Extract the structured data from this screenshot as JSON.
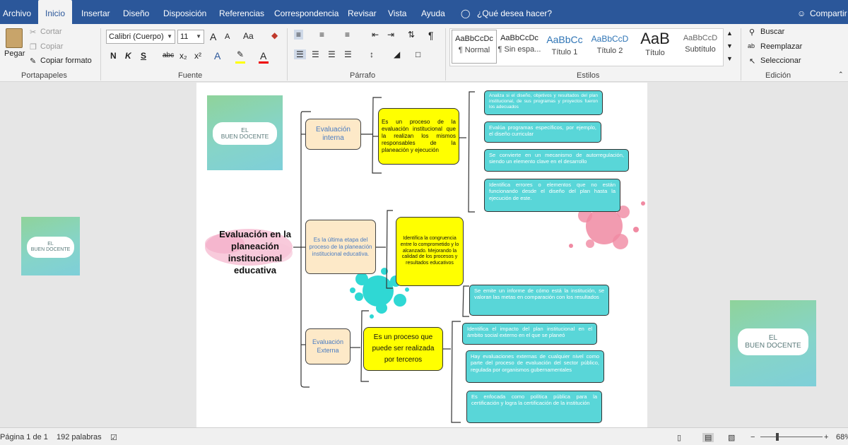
{
  "menu": {
    "tabs": [
      "Archivo",
      "Inicio",
      "Insertar",
      "Diseño",
      "Disposición",
      "Referencias",
      "Correspondencia",
      "Revisar",
      "Vista",
      "Ayuda"
    ],
    "tell_me": "¿Qué desea hacer?",
    "share": "Compartir"
  },
  "ribbon": {
    "clipboard": {
      "paste": "Pegar",
      "cut": "Cortar",
      "copy": "Copiar",
      "format_painter": "Copiar formato",
      "label": "Portapapeles"
    },
    "font": {
      "family": "Calibri (Cuerpo)",
      "size": "11",
      "label": "Fuente",
      "grow": "A",
      "shrink": "A",
      "case": "Aa",
      "bold": "N",
      "italic": "K",
      "underline": "S",
      "strike": "abc",
      "sub": "x₂",
      "sup": "x²"
    },
    "paragraph": {
      "label": "Párrafo",
      "pilcrow": "¶"
    },
    "styles": {
      "label": "Estilos",
      "items": [
        {
          "preview": "AaBbCcDc",
          "name": "¶ Normal"
        },
        {
          "preview": "AaBbCcDc",
          "name": "¶ Sin espa..."
        },
        {
          "preview": "AaBbCc",
          "name": "Título 1"
        },
        {
          "preview": "AaBbCcD",
          "name": "Título 2"
        },
        {
          "preview": "AaB",
          "name": "Título"
        },
        {
          "preview": "AaBbCcD",
          "name": "Subtítulo"
        }
      ]
    },
    "editing": {
      "find": "Buscar",
      "replace": "Reemplazar",
      "select": "Seleccionar",
      "label": "Edición"
    }
  },
  "logo": {
    "line1": "EL",
    "line2": "BUEN DOCENTE"
  },
  "mindmap": {
    "central": "Evaluación en la planeación institucional educativa",
    "branches": [
      {
        "label": "Evaluación interna",
        "detail": "Es un proceso de la evaluación institucional que la realizan los mismos responsables de la planeación y ejecución"
      },
      {
        "label": "Es la última etapa del proceso de la planeación institucional educativa.",
        "detail": "Identifica la congruencia entre lo comprometido y lo alcanzado. Mejorando la calidad de los procesos y resultados educativos"
      },
      {
        "label": "Evaluación Externa",
        "detail": "Es un proceso que puede ser realizada por terceros"
      }
    ],
    "notes": [
      "Analiza si el diseño, objetivos y resultados del plan institucional, de sus programas y proyectos fueron los adecuados",
      "Evalúa programas específicos, por ejemplo, el diseño curricular",
      "Se convierte en un mecanismo de autorregulación, siendo un elemento clave en el desarrollo",
      "Identifica errores o elementos que no están funcionando desde el diseño del plan hasta la ejecución de este.",
      "Se emite un informe de cómo está la institución, se valoran las metas en comparación con los resultados",
      "Identifica el impacto del plan institucional en el ámbito social externo en el que se planeó",
      "Hay evaluaciones externas de cualquier nivel como parte del proceso de evaluación del sector público, regulada por organismos gubernamentales",
      "Es enfocada como política pública para la certificación y logra la certificación de la institución"
    ]
  },
  "status": {
    "page": "Página 1 de 1",
    "words": "192 palabras",
    "zoom": "68%"
  },
  "colors": {
    "accent": "#2b579a",
    "teal": "#59d6d8",
    "yellow": "#ffff00",
    "peach": "#fde9c8"
  }
}
